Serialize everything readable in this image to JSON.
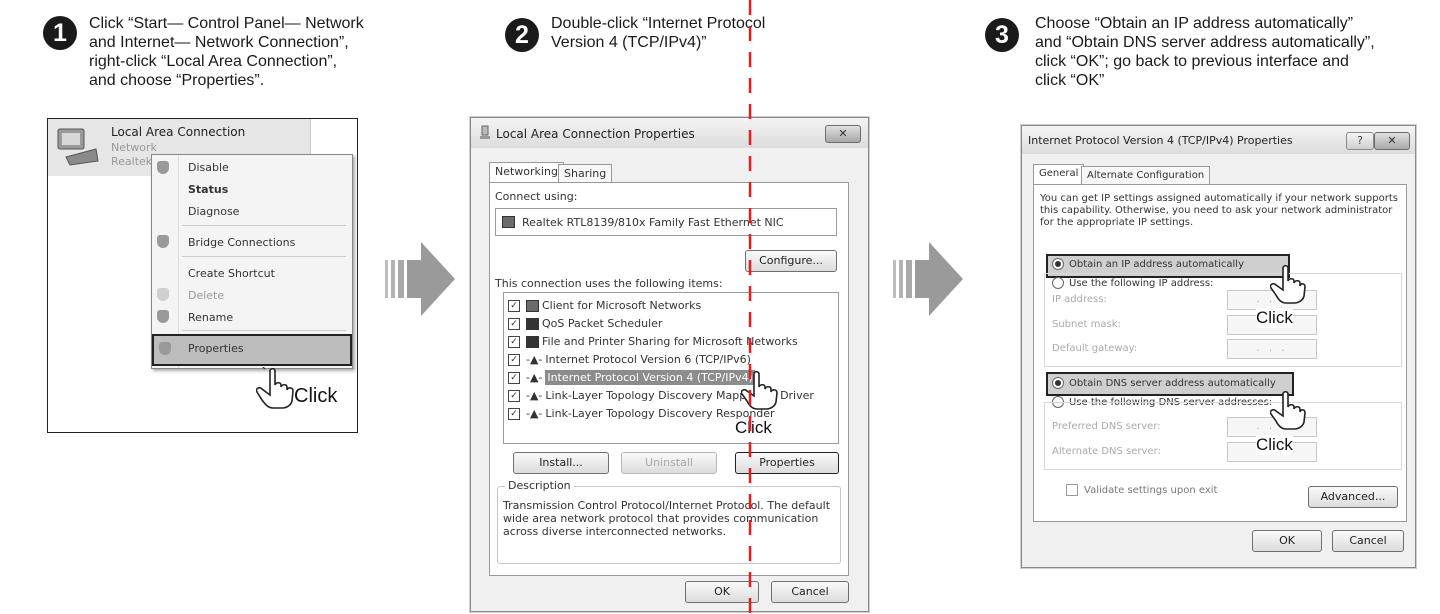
{
  "steps": [
    {
      "number": "1",
      "lines": [
        "Click “Start— Control Panel— Network",
        "and Internet— Network Connection”,",
        "right-click “Local Area Connection”,",
        "and choose “Properties”."
      ]
    },
    {
      "number": "2",
      "lines": [
        "Double-click “Internet Protocol",
        "Version 4 (TCP/IPv4)”"
      ]
    },
    {
      "number": "3",
      "lines": [
        "Choose “Obtain an IP address automatically”",
        "and “Obtain DNS server address automatically”,",
        "click “OK”; go back to previous interface and",
        " click “OK”"
      ]
    }
  ],
  "click_label": "Click",
  "panel1": {
    "connection_title": "Local Area Connection",
    "connection_sub1": "Network",
    "connection_sub2": "Realtek",
    "menu": [
      "Disable",
      "Status",
      "Diagnose",
      "Bridge Connections",
      "Create Shortcut",
      "Delete",
      "Rename",
      "Properties"
    ]
  },
  "panel2": {
    "title": "Local Area Connection Properties",
    "close": "✕",
    "tabs": [
      "Networking",
      "Sharing"
    ],
    "connect_using_label": "Connect using:",
    "adapter": "Realtek RTL8139/810x Family Fast Ethernet NIC",
    "configure_btn": "Configure...",
    "items_label": "This connection uses the following items:",
    "items": [
      "Client for Microsoft Networks",
      "QoS Packet Scheduler",
      "File and Printer Sharing for Microsoft Networks",
      "Internet Protocol Version 6 (TCP/IPv6)",
      "Internet Protocol Version 4 (TCP/IPv4)",
      "Link-Layer Topology Discovery Mapper I/O Driver",
      "Link-Layer Topology Discovery Responder"
    ],
    "install_btn": "Install...",
    "uninstall_btn": "Uninstall",
    "properties_btn": "Properties",
    "description_label": "Description",
    "description": "Transmission Control Protocol/Internet Protocol. The default wide area network protocol that provides communication across diverse interconnected networks.",
    "ok_btn": "OK",
    "cancel_btn": "Cancel"
  },
  "panel3": {
    "title": "Internet Protocol Version 4 (TCP/IPv4) Properties",
    "help": "?",
    "close": "✕",
    "tabs": [
      "General",
      "Alternate Configuration"
    ],
    "intro": "You can get IP settings assigned automatically if your network supports this capability. Otherwise, you need to ask your network administrator for the appropriate IP settings.",
    "obtain_ip": "Obtain an IP address automatically",
    "use_ip": "Use the following IP address:",
    "ip_address": "IP address:",
    "subnet_mask": "Subnet mask:",
    "default_gateway": "Default gateway:",
    "obtain_dns": "Obtain DNS server address automatically",
    "use_dns": "Use the following DNS server addresses:",
    "preferred_dns": "Preferred DNS server:",
    "alternate_dns": "Alternate DNS server:",
    "validate": "Validate settings upon exit",
    "advanced_btn": "Advanced...",
    "ok_btn": "OK",
    "cancel_btn": "Cancel",
    "field_dots": ". . ."
  }
}
